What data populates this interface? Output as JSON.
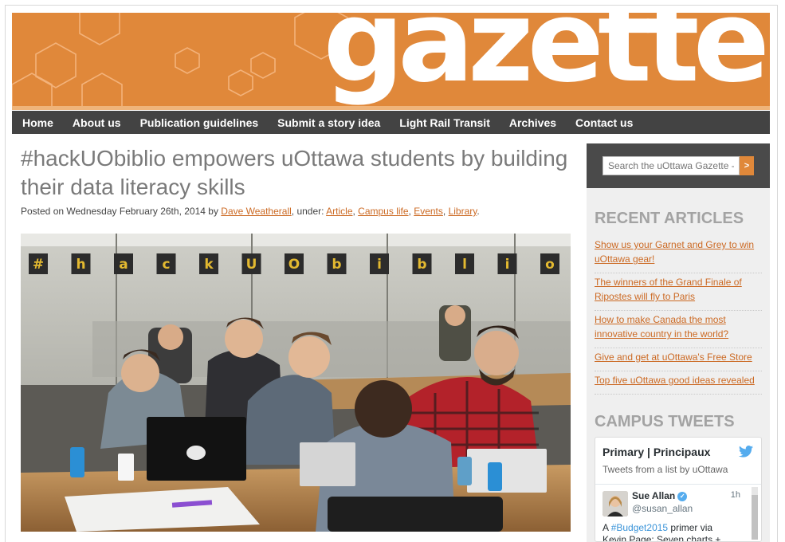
{
  "site": {
    "logo": "gazette",
    "colors": {
      "brand_orange": "#e0883a",
      "nav_bg": "#434343",
      "link": "#cc6a24",
      "heading_gray": "#a3a3a3"
    }
  },
  "nav": {
    "items": [
      {
        "label": "Home"
      },
      {
        "label": "About us"
      },
      {
        "label": "Publication guidelines"
      },
      {
        "label": "Submit a story idea"
      },
      {
        "label": "Light Rail Transit"
      },
      {
        "label": "Archives"
      },
      {
        "label": "Contact us"
      }
    ]
  },
  "article": {
    "title": "#hackUObiblio empowers uOttawa students by building their data literacy skills",
    "posted_prefix": "Posted on Wednesday February 26th, 2014 by ",
    "author": "Dave Weatherall",
    "under_label": ", under: ",
    "categories": [
      "Article",
      "Campus life",
      "Events",
      "Library"
    ],
    "sep": ", ",
    "period": ".",
    "photo_banner_letters": [
      "#",
      "h",
      "a",
      "c",
      "k",
      "U",
      "O",
      "b",
      "i",
      "b",
      "l",
      "i",
      "o"
    ]
  },
  "sidebar": {
    "search": {
      "placeholder": "Search the uOttawa Gazette -",
      "button": ">"
    },
    "recent_heading": "RECENT ARTICLES",
    "recent": [
      {
        "label": "Show us your Garnet and Grey to win uOttawa gear!"
      },
      {
        "label": "The winners of the Grand Finale of Ripostes will fly to Paris"
      },
      {
        "label": "How to make Canada the most innovative country in the world?"
      },
      {
        "label": "Give and get at uOttawa's Free Store"
      },
      {
        "label": "Top five uOttawa good ideas revealed"
      }
    ],
    "tweets_heading": "CAMPUS TWEETS",
    "tweets": {
      "title": "Primary | Principaux",
      "subtitle": "Tweets from a list by uOttawa",
      "icon": "twitter-bird-icon",
      "tweet": {
        "name": "Sue Allan",
        "handle": "@susan_allan",
        "time": "1h",
        "text_prefix": "A ",
        "hashtag": "#Budget2015",
        "text_suffix": " primer via Kevin Page: Seven charts +"
      }
    }
  }
}
